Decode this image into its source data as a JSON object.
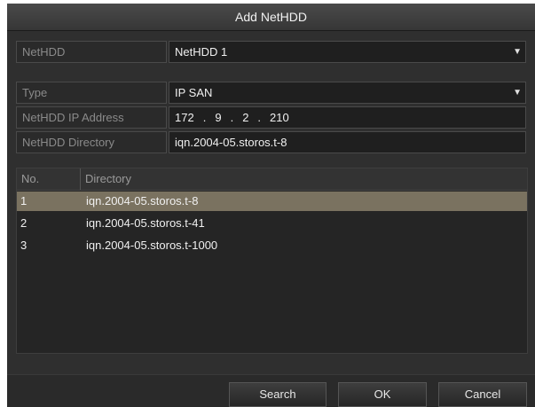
{
  "dialog": {
    "title": "Add NetHDD"
  },
  "form": {
    "nethdd": {
      "label": "NetHDD",
      "value": "NetHDD 1"
    },
    "type": {
      "label": "Type",
      "value": "IP SAN"
    },
    "ip": {
      "label": "NetHDD IP Address",
      "octets": [
        "172",
        "9",
        "2",
        "210"
      ]
    },
    "directory": {
      "label": "NetHDD Directory",
      "value": "iqn.2004-05.storos.t-8"
    }
  },
  "table": {
    "columns": [
      "No.",
      "Directory"
    ],
    "rows": [
      {
        "no": "1",
        "directory": "iqn.2004-05.storos.t-8",
        "selected": true
      },
      {
        "no": "2",
        "directory": "iqn.2004-05.storos.t-41",
        "selected": false
      },
      {
        "no": "3",
        "directory": "iqn.2004-05.storos.t-1000",
        "selected": false
      }
    ]
  },
  "buttons": {
    "search": "Search",
    "ok": "OK",
    "cancel": "Cancel"
  },
  "icons": {
    "dropdown": "chevron-down-icon"
  },
  "colors": {
    "selected_row": "#7a7260",
    "background": "#2f2f2f"
  }
}
